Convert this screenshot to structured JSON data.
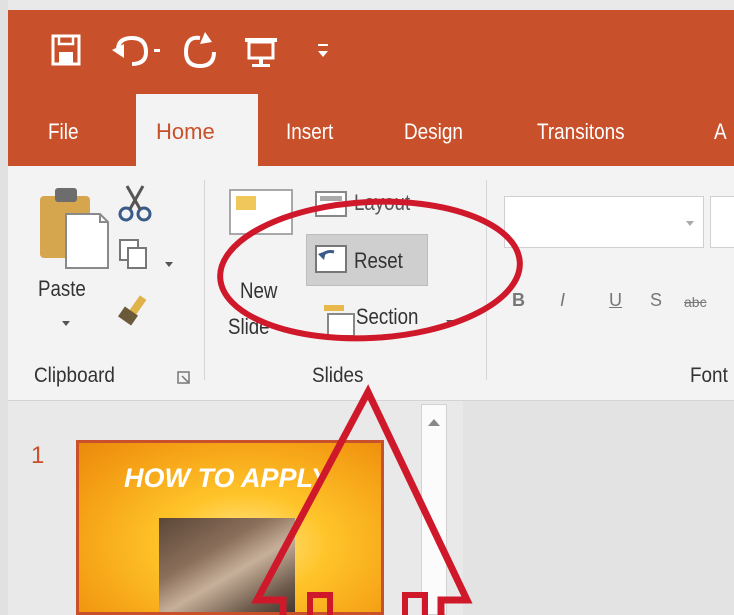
{
  "qat": {
    "icons": [
      "save-icon",
      "undo-icon",
      "redo-icon",
      "start-presentation-icon",
      "customize-qat-icon"
    ]
  },
  "tabs": [
    "File",
    "Home",
    "Insert",
    "Design",
    "Transitons",
    "A"
  ],
  "clipboard": {
    "paste_label": "Paste",
    "group_label": "Clipboard"
  },
  "slides_group": {
    "new_slide_line1": "New",
    "new_slide_line2": "Slide",
    "layout_label": "Layout",
    "reset_label": "Reset",
    "section_label": "Section",
    "group_label": "Slides"
  },
  "font_group": {
    "format_buttons": [
      "B",
      "I",
      "U",
      "S",
      "abc"
    ],
    "group_label": "Font"
  },
  "slide_pane": {
    "slide_number": "1",
    "slide_title": "HOW TO APPLY"
  },
  "colors": {
    "accent": "#c8502b",
    "annotation": "#d0182b"
  }
}
